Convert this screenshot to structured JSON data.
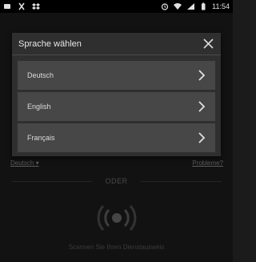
{
  "statusbar": {
    "time": "11:54",
    "left_icons": [
      "game-icon",
      "x-icon",
      "dropbox-icon"
    ],
    "right_icons": [
      "alarm-icon",
      "wifi-icon",
      "signal-icon",
      "battery-icon"
    ]
  },
  "background": {
    "language_link": "Deutsch ▾",
    "problems_link": "Probleme?",
    "divider_text": "ODER",
    "scan_text": "Scannen Sie Ihren Dienstausweis"
  },
  "dialog": {
    "title": "Sprache wählen",
    "languages": [
      {
        "label": "Deutsch"
      },
      {
        "label": "English"
      },
      {
        "label": "Français"
      }
    ]
  }
}
